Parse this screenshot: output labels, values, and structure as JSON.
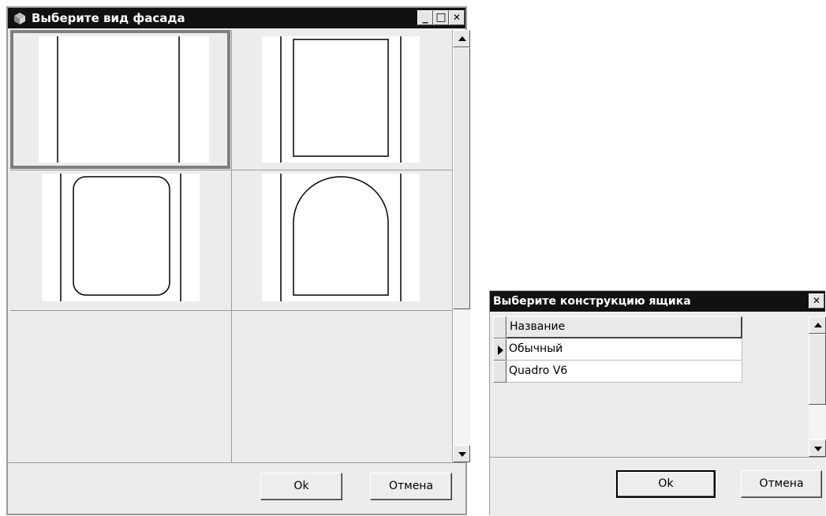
{
  "facade_dialog": {
    "title": "Выберите вид фасада",
    "window_buttons": {
      "minimize": "_",
      "maximize": "□",
      "close": "✕"
    },
    "facade_options": [
      {
        "name": "straight-frame",
        "selected": true
      },
      {
        "name": "rectangular-panel",
        "selected": false
      },
      {
        "name": "rounded-panel",
        "selected": false
      },
      {
        "name": "arched-panel",
        "selected": false
      }
    ],
    "ok_label": "Ok",
    "cancel_label": "Отмена"
  },
  "drawer_dialog": {
    "title": "Выберите конструкцию ящика",
    "close_label": "✕",
    "column_header": "Название",
    "rows": [
      {
        "name": "Обычный",
        "current": true
      },
      {
        "name": "Quadro V6",
        "current": false
      }
    ],
    "ok_label": "Ok",
    "cancel_label": "Отмена"
  }
}
